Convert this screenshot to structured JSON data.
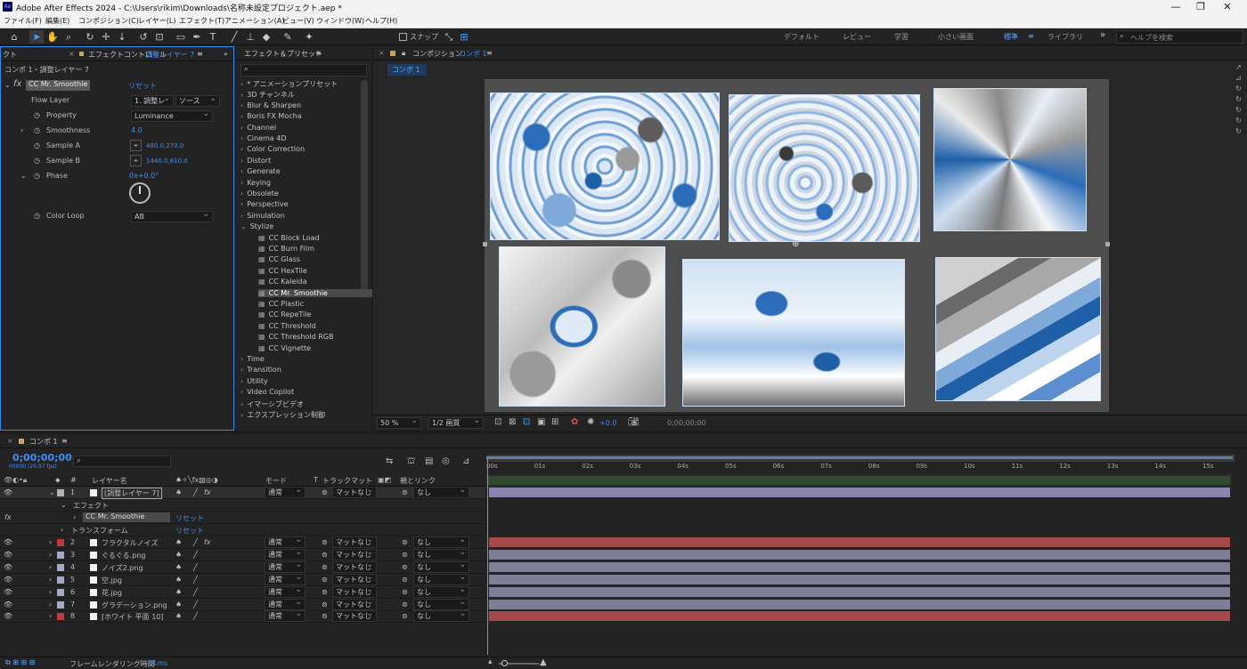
{
  "titlebar": {
    "title": "Adobe After Effects 2024 - C:\\Users\\rikim\\Downloads\\名称未設定プロジェクト.aep *",
    "app_badge": "Ae",
    "min": "—",
    "max": "❐",
    "close": "✕"
  },
  "menu": [
    "ファイル(F)",
    "編集(E)",
    "コンポジション(C)",
    "レイヤー(L)",
    "エフェクト(T)",
    "アニメーション(A)",
    "ビュー(V)",
    "ウィンドウ(W)",
    "ヘルプ(H)"
  ],
  "toolbar": {
    "snap_label": "スナップ",
    "workspaces": [
      "デフォルト",
      "レビュー",
      "学習",
      "小さい画面",
      "標準",
      "ライブラリ"
    ],
    "active_workspace": "標準",
    "more": "»",
    "search_placeholder": "ヘルプを検索"
  },
  "effect_controls": {
    "tab_prefix": "クト",
    "tab_label": "エフェクトコントロール",
    "tab_layer": "調整レイヤー 7",
    "breadcrumb": "コンポ 1・調整レイヤー 7",
    "effect_name": "CC Mr. Smoothie",
    "reset": "リセット",
    "props": [
      {
        "label": "Flow Layer",
        "value": "1. 調整レ",
        "value2": "ソース"
      },
      {
        "label": "Property",
        "value": "Luminance"
      },
      {
        "label": "Smoothness",
        "value": "4.0"
      },
      {
        "label": "Sample A",
        "value": "480.0,270.0"
      },
      {
        "label": "Sample B",
        "value": "1440.0,810.0"
      },
      {
        "label": "Phase",
        "value": "0x+0.0°"
      },
      {
        "label": "Color Loop",
        "value": "AB"
      }
    ]
  },
  "effects_presets": {
    "tab_label": "エフェクト＆プリセット",
    "search_placeholder": "",
    "categories_top": [
      "* アニメーションプリセット",
      "3D チャンネル",
      "Blur & Sharpen",
      "Boris FX Mocha",
      "Channel",
      "Cinema 4D",
      "Color Correction",
      "Distort",
      "Generate",
      "Keying",
      "Obsolete",
      "Perspective",
      "Simulation",
      "Stylize"
    ],
    "stylize_items": [
      "CC Block Load",
      "CC Burn Film",
      "CC Glass",
      "CC HexTile",
      "CC Kaleida",
      "CC Mr. Smoothie",
      "CC Plastic",
      "CC RepeTile",
      "CC Threshold",
      "CC Threshold RGB",
      "CC Vignette"
    ],
    "selected_item": "CC Mr. Smoothie",
    "categories_bottom": [
      "Time",
      "Transition",
      "Utility",
      "Video Copilot",
      "イマーシブビデオ",
      "エクスプレッション制御"
    ]
  },
  "composition": {
    "tab_prefix": "コンポジション",
    "tab_name": "コンポ 1",
    "subtab": "コンポ 1",
    "zoom": "50 %",
    "resolution": "1/2 画質",
    "exposure": "+0.0",
    "timecode": "0;00;00;00"
  },
  "timeline": {
    "tab": "コンポ 1",
    "timecode": "0;00;00;00",
    "fps": "00000 (29.97 fps)",
    "headers": {
      "name": "レイヤー名",
      "mode": "モード",
      "t": "T",
      "track": "トラックマット",
      "parent": "親とリンク",
      "num": "#"
    },
    "ruler": [
      "00s",
      "01s",
      "02s",
      "03s",
      "04s",
      "05s",
      "06s",
      "07s",
      "08s",
      "09s",
      "10s",
      "11s",
      "12s",
      "13s",
      "14s",
      "15s"
    ],
    "sub": {
      "effects": "エフェクト",
      "effect_name": "CC Mr. Smoothie",
      "reset": "リセット",
      "transform": "トランスフォーム",
      "reset2": "リセット"
    },
    "layers": [
      {
        "num": "1",
        "name": "[調整レイヤー 7]",
        "mode": "通常",
        "matte": "マットなし",
        "parent": "なし",
        "label": "#b3b3b3",
        "bar": "#8a86ad"
      },
      {
        "num": "2",
        "name": "フラクタルノイズ",
        "mode": "通常",
        "matte": "マットなし",
        "parent": "なし",
        "label": "#c03a3a",
        "bar": "#a44a4a"
      },
      {
        "num": "3",
        "name": "ぐるぐる.png",
        "mode": "通常",
        "matte": "マットなし",
        "parent": "なし",
        "label": "#a6a8c8",
        "bar": "#7e7f96"
      },
      {
        "num": "4",
        "name": "ノイズ2.png",
        "mode": "通常",
        "matte": "マットなし",
        "parent": "なし",
        "label": "#a6a8c8",
        "bar": "#7e7f96"
      },
      {
        "num": "5",
        "name": "空.jpg",
        "mode": "通常",
        "matte": "マットなし",
        "parent": "なし",
        "label": "#a6a8c8",
        "bar": "#7e7f96"
      },
      {
        "num": "6",
        "name": "花.jpg",
        "mode": "通常",
        "matte": "マットなし",
        "parent": "なし",
        "label": "#a6a8c8",
        "bar": "#7e7f96"
      },
      {
        "num": "7",
        "name": "グラデーション.png",
        "mode": "通常",
        "matte": "マットなし",
        "parent": "なし",
        "label": "#a6a8c8",
        "bar": "#7e7f96"
      },
      {
        "num": "8",
        "name": "[ホワイト 平面 10]",
        "mode": "通常",
        "matte": "マットなし",
        "parent": "なし",
        "label": "#c03a3a",
        "bar": "#a44a4a"
      }
    ]
  },
  "statusbar": {
    "render_label": "フレームレンダリング時間",
    "render_time": "11ms"
  }
}
